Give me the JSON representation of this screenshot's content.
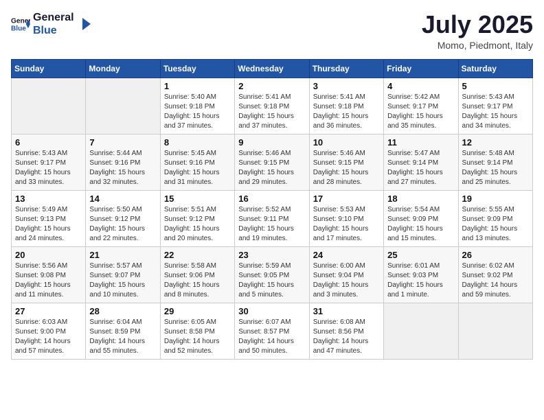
{
  "header": {
    "logo_general": "General",
    "logo_blue": "Blue",
    "month_title": "July 2025",
    "location": "Momo, Piedmont, Italy"
  },
  "weekdays": [
    "Sunday",
    "Monday",
    "Tuesday",
    "Wednesday",
    "Thursday",
    "Friday",
    "Saturday"
  ],
  "weeks": [
    [
      {
        "day": "",
        "info": ""
      },
      {
        "day": "",
        "info": ""
      },
      {
        "day": "1",
        "info": "Sunrise: 5:40 AM\nSunset: 9:18 PM\nDaylight: 15 hours\nand 37 minutes."
      },
      {
        "day": "2",
        "info": "Sunrise: 5:41 AM\nSunset: 9:18 PM\nDaylight: 15 hours\nand 37 minutes."
      },
      {
        "day": "3",
        "info": "Sunrise: 5:41 AM\nSunset: 9:18 PM\nDaylight: 15 hours\nand 36 minutes."
      },
      {
        "day": "4",
        "info": "Sunrise: 5:42 AM\nSunset: 9:17 PM\nDaylight: 15 hours\nand 35 minutes."
      },
      {
        "day": "5",
        "info": "Sunrise: 5:43 AM\nSunset: 9:17 PM\nDaylight: 15 hours\nand 34 minutes."
      }
    ],
    [
      {
        "day": "6",
        "info": "Sunrise: 5:43 AM\nSunset: 9:17 PM\nDaylight: 15 hours\nand 33 minutes."
      },
      {
        "day": "7",
        "info": "Sunrise: 5:44 AM\nSunset: 9:16 PM\nDaylight: 15 hours\nand 32 minutes."
      },
      {
        "day": "8",
        "info": "Sunrise: 5:45 AM\nSunset: 9:16 PM\nDaylight: 15 hours\nand 31 minutes."
      },
      {
        "day": "9",
        "info": "Sunrise: 5:46 AM\nSunset: 9:15 PM\nDaylight: 15 hours\nand 29 minutes."
      },
      {
        "day": "10",
        "info": "Sunrise: 5:46 AM\nSunset: 9:15 PM\nDaylight: 15 hours\nand 28 minutes."
      },
      {
        "day": "11",
        "info": "Sunrise: 5:47 AM\nSunset: 9:14 PM\nDaylight: 15 hours\nand 27 minutes."
      },
      {
        "day": "12",
        "info": "Sunrise: 5:48 AM\nSunset: 9:14 PM\nDaylight: 15 hours\nand 25 minutes."
      }
    ],
    [
      {
        "day": "13",
        "info": "Sunrise: 5:49 AM\nSunset: 9:13 PM\nDaylight: 15 hours\nand 24 minutes."
      },
      {
        "day": "14",
        "info": "Sunrise: 5:50 AM\nSunset: 9:12 PM\nDaylight: 15 hours\nand 22 minutes."
      },
      {
        "day": "15",
        "info": "Sunrise: 5:51 AM\nSunset: 9:12 PM\nDaylight: 15 hours\nand 20 minutes."
      },
      {
        "day": "16",
        "info": "Sunrise: 5:52 AM\nSunset: 9:11 PM\nDaylight: 15 hours\nand 19 minutes."
      },
      {
        "day": "17",
        "info": "Sunrise: 5:53 AM\nSunset: 9:10 PM\nDaylight: 15 hours\nand 17 minutes."
      },
      {
        "day": "18",
        "info": "Sunrise: 5:54 AM\nSunset: 9:09 PM\nDaylight: 15 hours\nand 15 minutes."
      },
      {
        "day": "19",
        "info": "Sunrise: 5:55 AM\nSunset: 9:09 PM\nDaylight: 15 hours\nand 13 minutes."
      }
    ],
    [
      {
        "day": "20",
        "info": "Sunrise: 5:56 AM\nSunset: 9:08 PM\nDaylight: 15 hours\nand 11 minutes."
      },
      {
        "day": "21",
        "info": "Sunrise: 5:57 AM\nSunset: 9:07 PM\nDaylight: 15 hours\nand 10 minutes."
      },
      {
        "day": "22",
        "info": "Sunrise: 5:58 AM\nSunset: 9:06 PM\nDaylight: 15 hours\nand 8 minutes."
      },
      {
        "day": "23",
        "info": "Sunrise: 5:59 AM\nSunset: 9:05 PM\nDaylight: 15 hours\nand 5 minutes."
      },
      {
        "day": "24",
        "info": "Sunrise: 6:00 AM\nSunset: 9:04 PM\nDaylight: 15 hours\nand 3 minutes."
      },
      {
        "day": "25",
        "info": "Sunrise: 6:01 AM\nSunset: 9:03 PM\nDaylight: 15 hours\nand 1 minute."
      },
      {
        "day": "26",
        "info": "Sunrise: 6:02 AM\nSunset: 9:02 PM\nDaylight: 14 hours\nand 59 minutes."
      }
    ],
    [
      {
        "day": "27",
        "info": "Sunrise: 6:03 AM\nSunset: 9:00 PM\nDaylight: 14 hours\nand 57 minutes."
      },
      {
        "day": "28",
        "info": "Sunrise: 6:04 AM\nSunset: 8:59 PM\nDaylight: 14 hours\nand 55 minutes."
      },
      {
        "day": "29",
        "info": "Sunrise: 6:05 AM\nSunset: 8:58 PM\nDaylight: 14 hours\nand 52 minutes."
      },
      {
        "day": "30",
        "info": "Sunrise: 6:07 AM\nSunset: 8:57 PM\nDaylight: 14 hours\nand 50 minutes."
      },
      {
        "day": "31",
        "info": "Sunrise: 6:08 AM\nSunset: 8:56 PM\nDaylight: 14 hours\nand 47 minutes."
      },
      {
        "day": "",
        "info": ""
      },
      {
        "day": "",
        "info": ""
      }
    ]
  ]
}
